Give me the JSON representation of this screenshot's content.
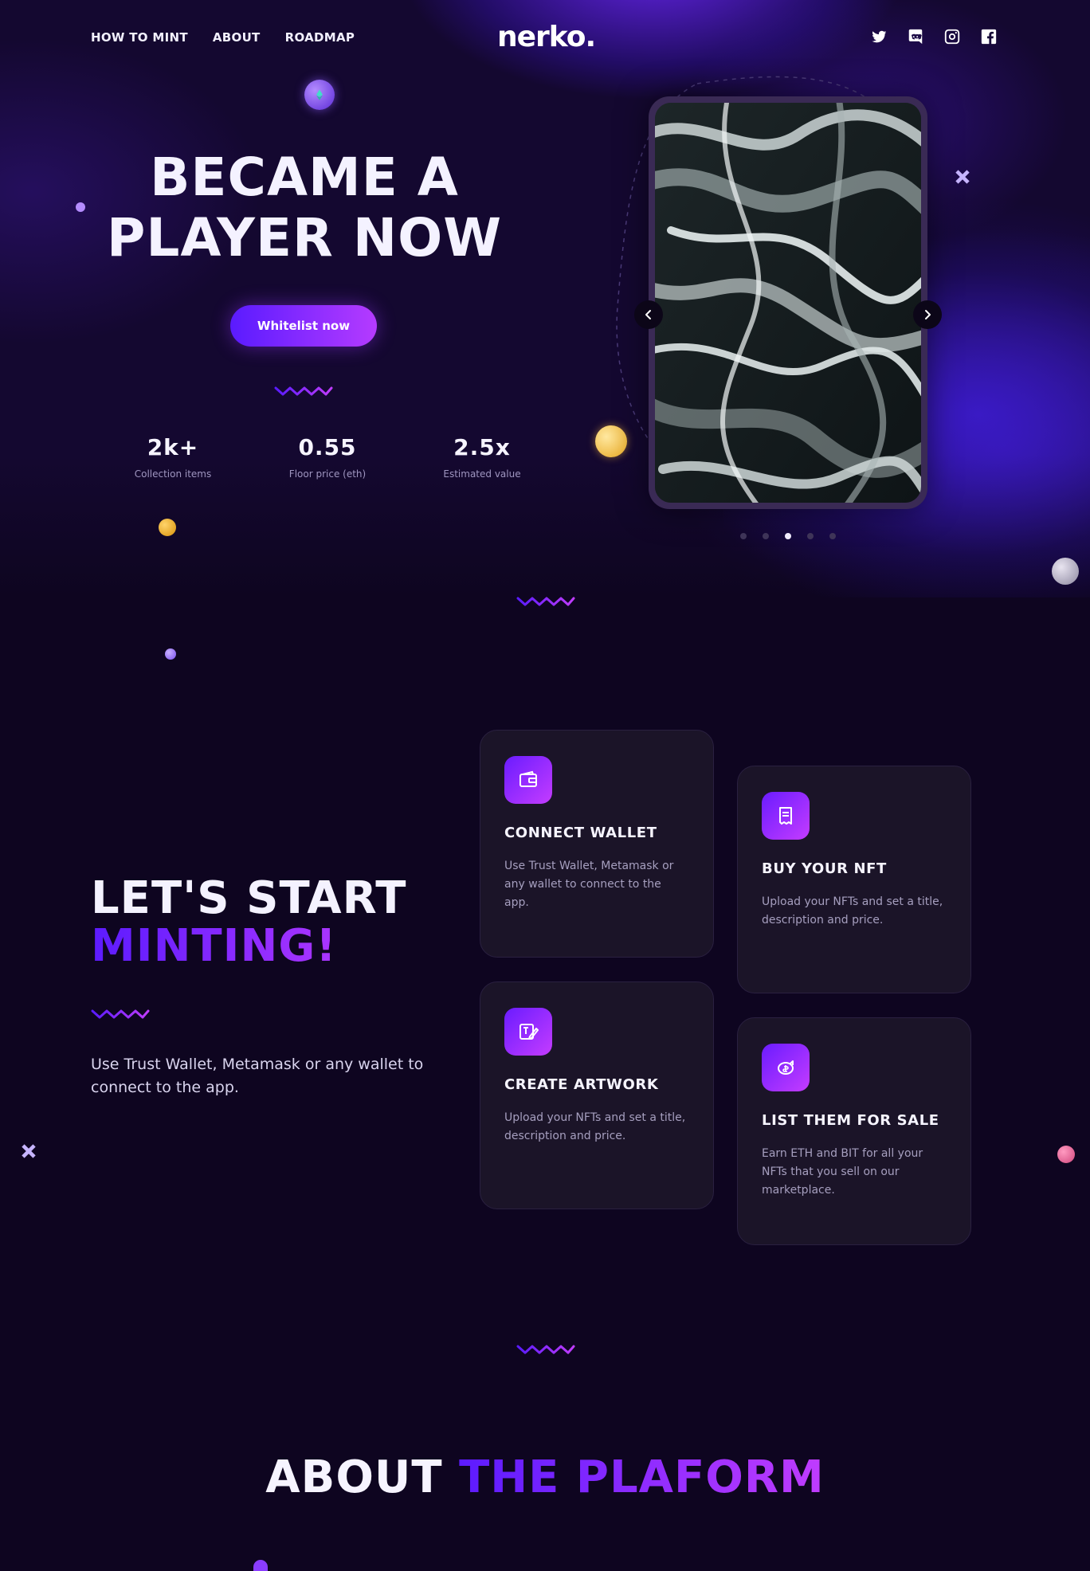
{
  "nav": {
    "links": [
      "HOW TO MINT",
      "ABOUT",
      "ROADMAP"
    ],
    "logo": "nerko.",
    "socials": [
      "twitter-icon",
      "discord-icon",
      "instagram-icon",
      "facebook-icon"
    ]
  },
  "hero": {
    "title_line1": "BECAME A",
    "title_line2": "PLAYER NOW",
    "cta": "Whitelist now",
    "stats": [
      {
        "value": "2k+",
        "label": "Collection items"
      },
      {
        "value": "0.55",
        "label": "Floor price (eth)"
      },
      {
        "value": "2.5x",
        "label": "Estimated value"
      }
    ],
    "carousel": {
      "active_index": 2,
      "total": 5
    }
  },
  "minting": {
    "title_line1": "LET'S START",
    "title_line2": "MINTING!",
    "description": "Use Trust Wallet, Metamask or any wallet to connect to the app.",
    "cards": [
      {
        "icon": "wallet-icon",
        "title": "CONNECT WALLET",
        "text": "Use Trust Wallet, Metamask or any wallet to connect to the app."
      },
      {
        "icon": "receipt-icon",
        "title": "BUY YOUR NFT",
        "text": "Upload your NFTs and set a title, description and price."
      },
      {
        "icon": "create-artwork-icon",
        "title": "CREATE ARTWORK",
        "text": "Upload your NFTs and set a title, description and price."
      },
      {
        "icon": "piggy-bank-icon",
        "title": "LIST THEM FOR SALE",
        "text": "Earn ETH and BIT for all your NFTs that you sell on our marketplace."
      }
    ]
  },
  "about": {
    "title_white": "ABOUT",
    "title_gradient": "THE PLAFORM"
  },
  "colors": {
    "background": "#0e0520",
    "accent_start": "#5a1bff",
    "accent_end": "#b53bff",
    "card_bg": "#1b1428"
  }
}
